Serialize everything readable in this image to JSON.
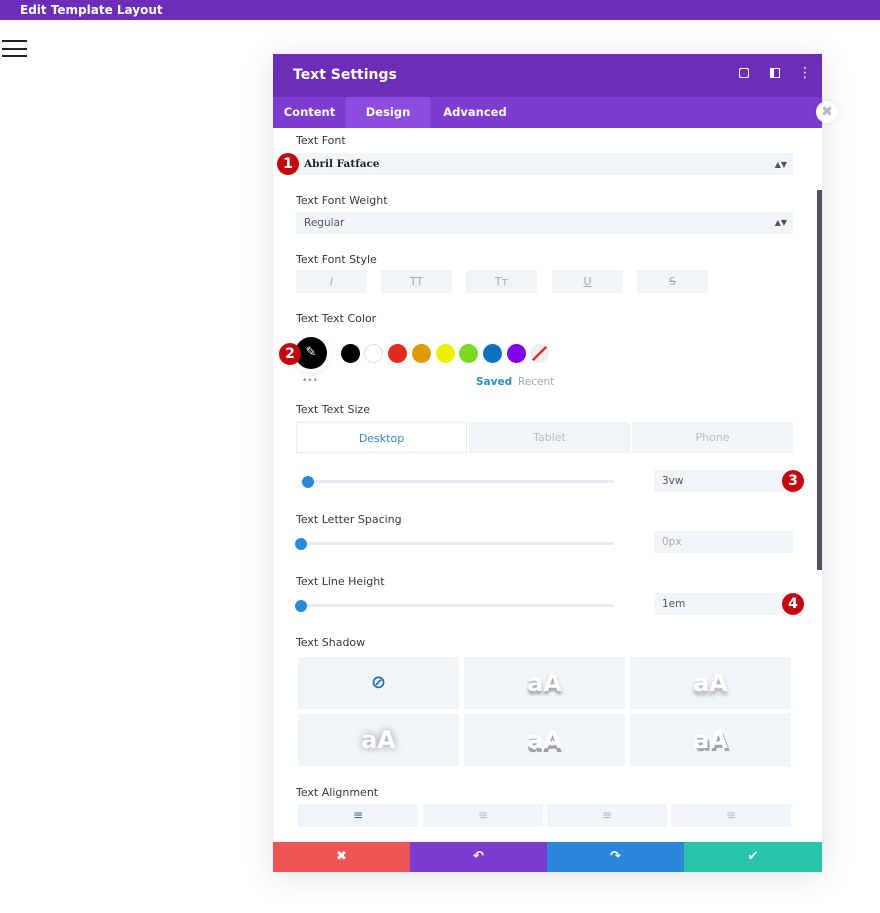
{
  "topbar": {
    "title": "Edit Template Layout"
  },
  "modal": {
    "title": "Text Settings",
    "header_icons": [
      "expand-icon",
      "sidebar-toggle-icon",
      "more-options-icon"
    ],
    "tabs": [
      {
        "label": "Content"
      },
      {
        "label": "Design"
      },
      {
        "label": "Advanced"
      }
    ],
    "active_tab": "Design"
  },
  "fields": {
    "font": {
      "label": "Text Font",
      "value": "Abril Fatface",
      "badge": "1"
    },
    "weight": {
      "label": "Text Font Weight",
      "value": "Regular"
    },
    "style": {
      "label": "Text Font Style",
      "buttons": [
        "I",
        "TT",
        "Tт",
        "U",
        "S"
      ]
    },
    "color": {
      "label": "Text Text Color",
      "badge": "2",
      "swatches": [
        "#000000",
        "#ffffff",
        "#e02b20",
        "#e09900",
        "#edf000",
        "#7cda24",
        "#0c71c3",
        "#8300e9"
      ],
      "more": "•••",
      "saved": "Saved",
      "recent": "Recent"
    },
    "size": {
      "label": "Text Text Size",
      "devices": [
        "Desktop",
        "Tablet",
        "Phone"
      ],
      "active_device": "Desktop",
      "value": "3vw",
      "badge": "3",
      "slider_percent": 2
    },
    "letter": {
      "label": "Text Letter Spacing",
      "value": "0px",
      "slider_percent": 0
    },
    "line": {
      "label": "Text Line Height",
      "value": "1em",
      "badge": "4",
      "slider_percent": 0
    },
    "shadow": {
      "label": "Text Shadow",
      "preview": "aA"
    },
    "align": {
      "label": "Text Alignment",
      "options": [
        "left",
        "center",
        "right",
        "justify"
      ],
      "active": "left"
    }
  },
  "footer": {
    "cancel": "✖",
    "undo": "↶",
    "redo": "↷",
    "save": "✔"
  },
  "colors": {
    "purple_dark": "#6c2eb9",
    "purple": "#7e3bd0",
    "red": "#ef5555",
    "blue": "#2b87da",
    "teal": "#29c4a9",
    "badge": "#c4060e"
  }
}
